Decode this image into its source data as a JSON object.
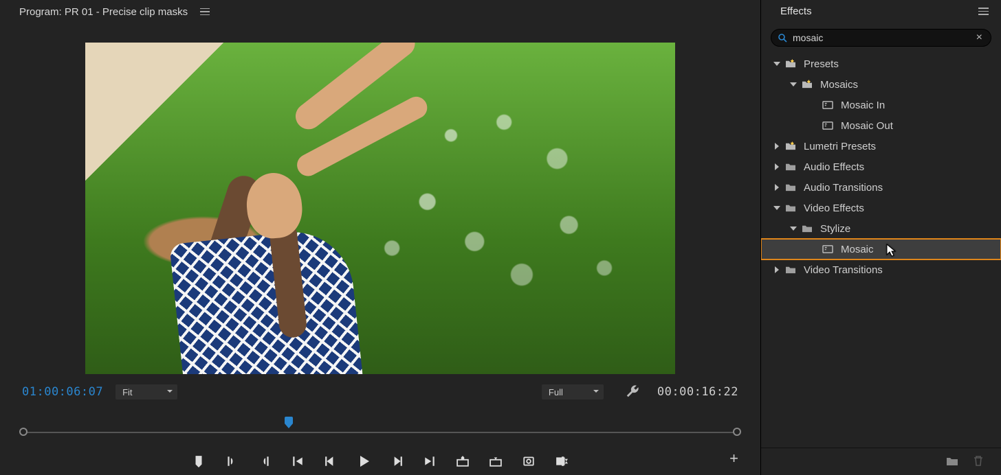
{
  "program": {
    "title": "Program: PR 01 - Precise clip masks",
    "timecode_current": "01:00:06:07",
    "timecode_duration": "00:00:16:22",
    "zoom_label": "Fit",
    "quality_label": "Full"
  },
  "effects": {
    "panel_title": "Effects",
    "search_value": "mosaic",
    "tree": {
      "presets": {
        "label": "Presets",
        "expanded": true
      },
      "mosaics_folder": {
        "label": "Mosaics",
        "expanded": true
      },
      "mosaic_in": {
        "label": "Mosaic In"
      },
      "mosaic_out": {
        "label": "Mosaic Out"
      },
      "lumetri": {
        "label": "Lumetri Presets",
        "expanded": false
      },
      "audio_effects": {
        "label": "Audio Effects",
        "expanded": false
      },
      "audio_transitions": {
        "label": "Audio Transitions",
        "expanded": false
      },
      "video_effects": {
        "label": "Video Effects",
        "expanded": true
      },
      "stylize": {
        "label": "Stylize",
        "expanded": true
      },
      "mosaic_effect": {
        "label": "Mosaic",
        "selected": true
      },
      "video_transitions": {
        "label": "Video Transitions",
        "expanded": false
      }
    }
  },
  "colors": {
    "accent_blue": "#2a86cf",
    "highlight_orange": "#e0861a",
    "panel_bg": "#232323"
  }
}
